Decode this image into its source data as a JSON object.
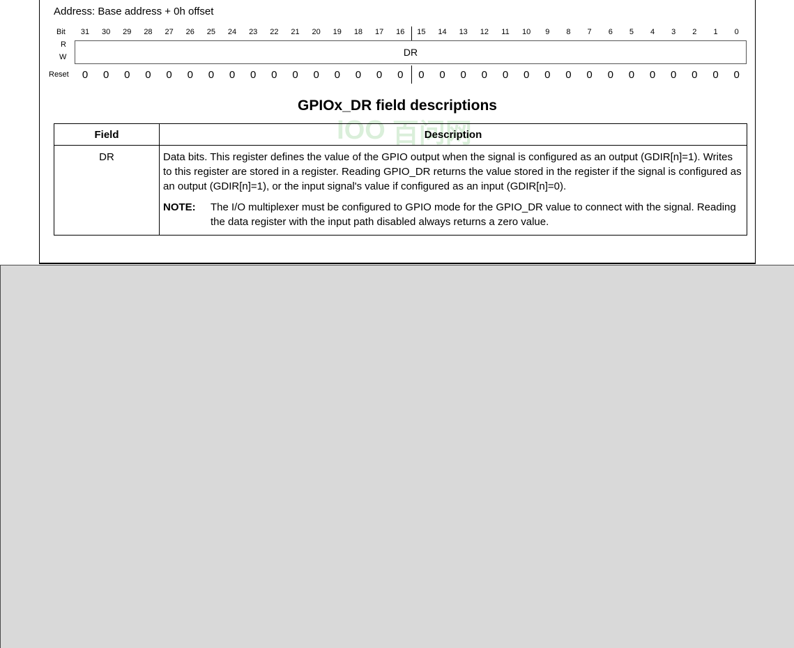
{
  "register": {
    "address": "Address: Base address + 0h offset",
    "bit_label": "Bit",
    "read_label": "R",
    "write_label": "W",
    "reset_label": "Reset",
    "bits": [
      "31",
      "30",
      "29",
      "28",
      "27",
      "26",
      "25",
      "24",
      "23",
      "22",
      "21",
      "20",
      "19",
      "18",
      "17",
      "16",
      "15",
      "14",
      "13",
      "12",
      "11",
      "10",
      "9",
      "8",
      "7",
      "6",
      "5",
      "4",
      "3",
      "2",
      "1",
      "0"
    ],
    "resets": [
      "0",
      "0",
      "0",
      "0",
      "0",
      "0",
      "0",
      "0",
      "0",
      "0",
      "0",
      "0",
      "0",
      "0",
      "0",
      "0",
      "0",
      "0",
      "0",
      "0",
      "0",
      "0",
      "0",
      "0",
      "0",
      "0",
      "0",
      "0",
      "0",
      "0",
      "0",
      "0"
    ],
    "field_name": "DR"
  },
  "table": {
    "title": "GPIOx_DR field descriptions",
    "headers": [
      "Field",
      "Description"
    ],
    "rows": [
      {
        "field": "DR",
        "description": "Data bits. This register defines the value of the GPIO output when the signal is configured as an output (GDIR[n]=1). Writes to this register are stored in a register. Reading GPIO_DR returns the value stored in the register if the signal is configured as an output (GDIR[n]=1), or the input signal's value if configured as an input (GDIR[n]=0).",
        "note_label": "NOTE:",
        "note_text": "The I/O multiplexer must be configured to GPIO mode for the GPIO_DR value to connect with the signal. Reading the data register with the input path disabled always returns a zero value."
      }
    ]
  },
  "watermark": {
    "symbol": "IOO",
    "text": "百问网"
  }
}
